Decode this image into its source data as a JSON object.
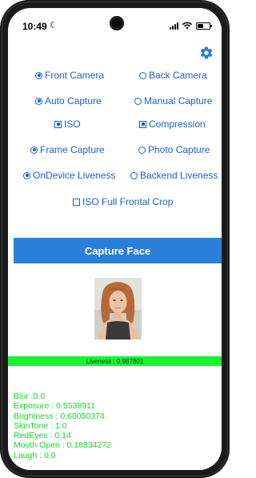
{
  "status_bar": {
    "time": "10:49"
  },
  "options": {
    "row1": {
      "left": "Front Camera",
      "right": "Back Camera"
    },
    "row2": {
      "left": "Auto Capture",
      "right": "Manual Capture"
    },
    "row3": {
      "left": "ISO",
      "right": "Compression"
    },
    "row4": {
      "left": "Frame Capture",
      "right": "Photo Capture"
    },
    "row5": {
      "left": "OnDevice Liveness",
      "right": "Backend Liveness"
    },
    "row6": {
      "center": "ISO Full Frontal Crop"
    }
  },
  "capture_button": {
    "label": "Capture Face"
  },
  "liveness": {
    "label": "Liveness : 0.987801"
  },
  "metrics": [
    "Blur :0.0",
    "Exposure : 0.5538911",
    "Brightness : 0.60050374",
    "SkinTone : 1.0",
    "RedEyes : 0.14",
    "Mouth Open : 0.18834272",
    "Laugh : 0.0"
  ],
  "colors": {
    "accent_blue": "#1f5fd1",
    "button_blue": "#2a7fd8",
    "liveness_green": "#19f233",
    "metric_green": "#18d82a"
  }
}
